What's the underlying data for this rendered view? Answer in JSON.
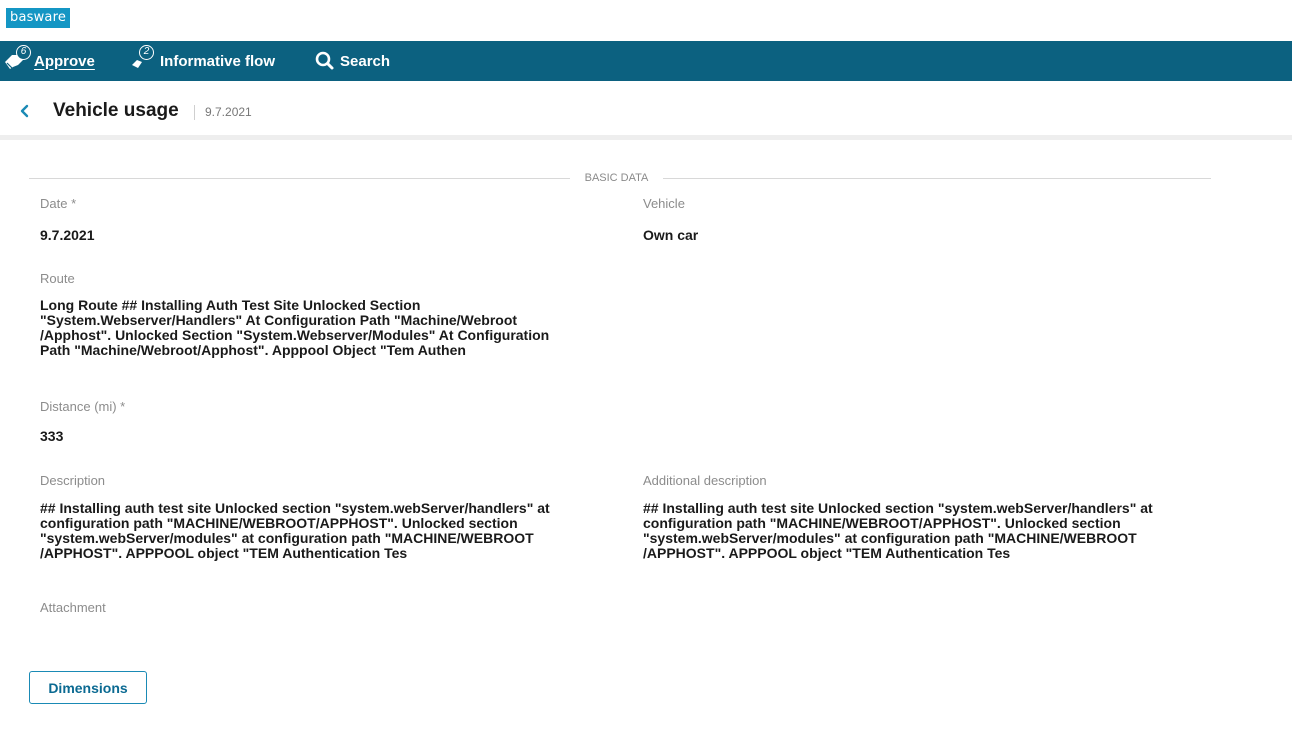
{
  "app": {
    "logo_text": "basware"
  },
  "nav": {
    "approve": {
      "label": "Approve",
      "badge": "6",
      "icon": "approve-hand-icon"
    },
    "informative": {
      "label": "Informative flow",
      "badge": "2",
      "icon": "informative-flow-icon"
    },
    "search": {
      "label": "Search",
      "icon": "search-icon"
    }
  },
  "header": {
    "title": "Vehicle usage",
    "date": "9.7.2021"
  },
  "section": {
    "title": "BASIC DATA"
  },
  "fields": {
    "date": {
      "label": "Date *",
      "value": "9.7.2021"
    },
    "vehicle": {
      "label": "Vehicle",
      "value": "Own car"
    },
    "route": {
      "label": "Route",
      "lines": [
        "Long Route ## Installing Auth Test Site Unlocked Section",
        "\"System.Webserver/Handlers\" At Configuration Path \"Machine/Webroot",
        "/Apphost\". Unlocked Section \"System.Webserver/Modules\" At Configuration",
        "Path \"Machine/Webroot/Apphost\". Apppool Object \"Tem Authen"
      ]
    },
    "distance": {
      "label": "Distance (mi) *",
      "value": "333"
    },
    "description": {
      "label": "Description",
      "lines": [
        "## Installing auth test site Unlocked section \"system.webServer/handlers\" at",
        "configuration path \"MACHINE/WEBROOT/APPHOST\". Unlocked section",
        "\"system.webServer/modules\" at configuration path \"MACHINE/WEBROOT",
        "/APPHOST\". APPPOOL object \"TEM Authentication Tes"
      ]
    },
    "additional_description": {
      "label": "Additional description",
      "lines": [
        "## Installing auth test site Unlocked section \"system.webServer/handlers\" at",
        "configuration path \"MACHINE/WEBROOT/APPHOST\". Unlocked section",
        "\"system.webServer/modules\" at configuration path \"MACHINE/WEBROOT",
        "/APPHOST\". APPPOOL object \"TEM Authentication Tes"
      ]
    },
    "attachment": {
      "label": "Attachment"
    }
  },
  "buttons": {
    "dimensions": "Dimensions"
  },
  "colors": {
    "nav_bg": "#0c6180",
    "logo_bg": "#1496c4",
    "accent": "#1a8ab5"
  }
}
